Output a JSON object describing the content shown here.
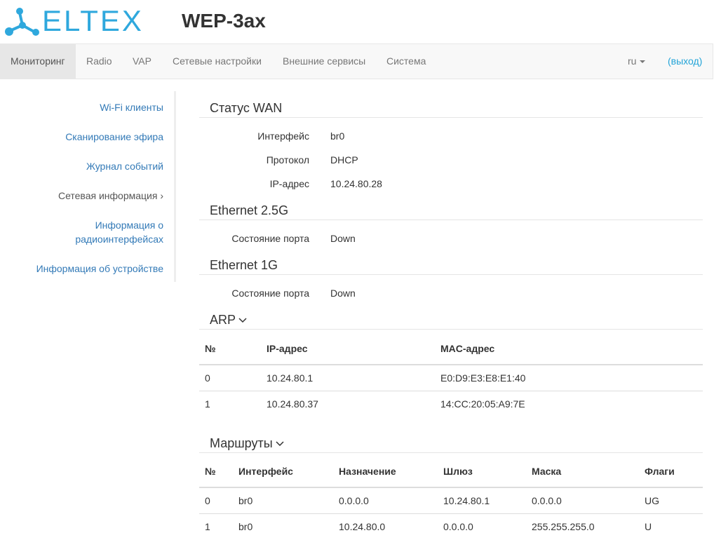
{
  "header": {
    "logo_text": "ELTEX",
    "product": "WEP-3ax"
  },
  "nav": {
    "items": [
      "Мониторинг",
      "Radio",
      "VAP",
      "Сетевые настройки",
      "Внешние сервисы",
      "Система"
    ],
    "lang": "ru",
    "logout": "(выход)"
  },
  "sidebar": {
    "items": [
      "Wi-Fi клиенты",
      "Сканирование эфира",
      "Журнал событий",
      "Сетевая информация ›",
      "Информация о радиоинтерфейсах",
      "Информация об устройстве"
    ]
  },
  "wan": {
    "title": "Статус WAN",
    "rows": [
      {
        "label": "Интерфейс",
        "value": "br0"
      },
      {
        "label": "Протокол",
        "value": "DHCP"
      },
      {
        "label": "IP-адрес",
        "value": "10.24.80.28"
      }
    ]
  },
  "eth25": {
    "title": "Ethernet 2.5G",
    "label": "Состояние порта",
    "value": "Down"
  },
  "eth1": {
    "title": "Ethernet 1G",
    "label": "Состояние порта",
    "value": "Down"
  },
  "arp": {
    "title": "ARP",
    "headers": [
      "№",
      "IP-адрес",
      "MAC-адрес"
    ],
    "rows": [
      [
        "0",
        "10.24.80.1",
        "E0:D9:E3:E8:E1:40"
      ],
      [
        "1",
        "10.24.80.37",
        "14:CC:20:05:A9:7E"
      ]
    ]
  },
  "routes": {
    "title": "Маршруты",
    "headers": [
      "№",
      "Интерфейс",
      "Назначение",
      "Шлюз",
      "Маска",
      "Флаги"
    ],
    "rows": [
      [
        "0",
        "br0",
        "0.0.0.0",
        "10.24.80.1",
        "0.0.0.0",
        "UG"
      ],
      [
        "1",
        "br0",
        "10.24.80.0",
        "0.0.0.0",
        "255.255.255.0",
        "U"
      ]
    ]
  },
  "colors": {
    "brand": "#2fa8dd",
    "link": "#337ab7"
  }
}
